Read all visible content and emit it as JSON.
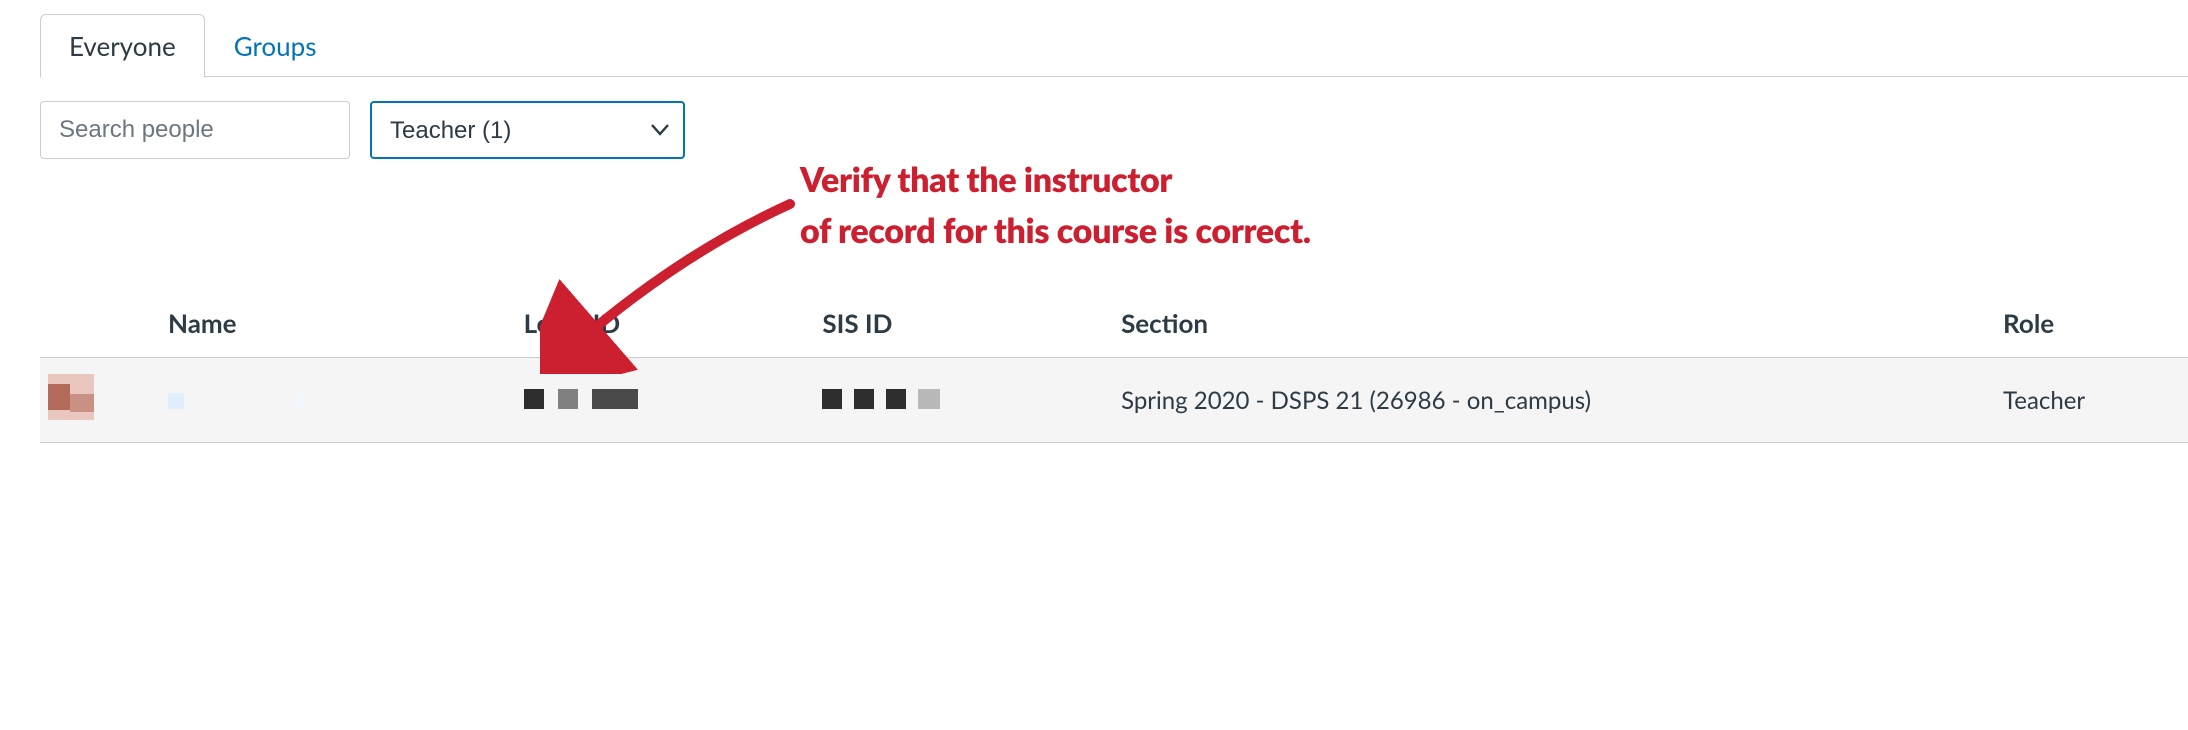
{
  "tabs": {
    "everyone": "Everyone",
    "groups": "Groups"
  },
  "filters": {
    "search_placeholder": "Search people",
    "role_selected": "Teacher (1)"
  },
  "annotation": {
    "line1": "Verify that the instructor",
    "line2": "of record for this course is correct."
  },
  "table": {
    "headers": {
      "name": "Name",
      "login_id": "Login ID",
      "sis_id": "SIS ID",
      "section": "Section",
      "role": "Role"
    },
    "rows": [
      {
        "section": "Spring 2020 - DSPS 21 (26986 - on_campus)",
        "role": "Teacher"
      }
    ]
  }
}
